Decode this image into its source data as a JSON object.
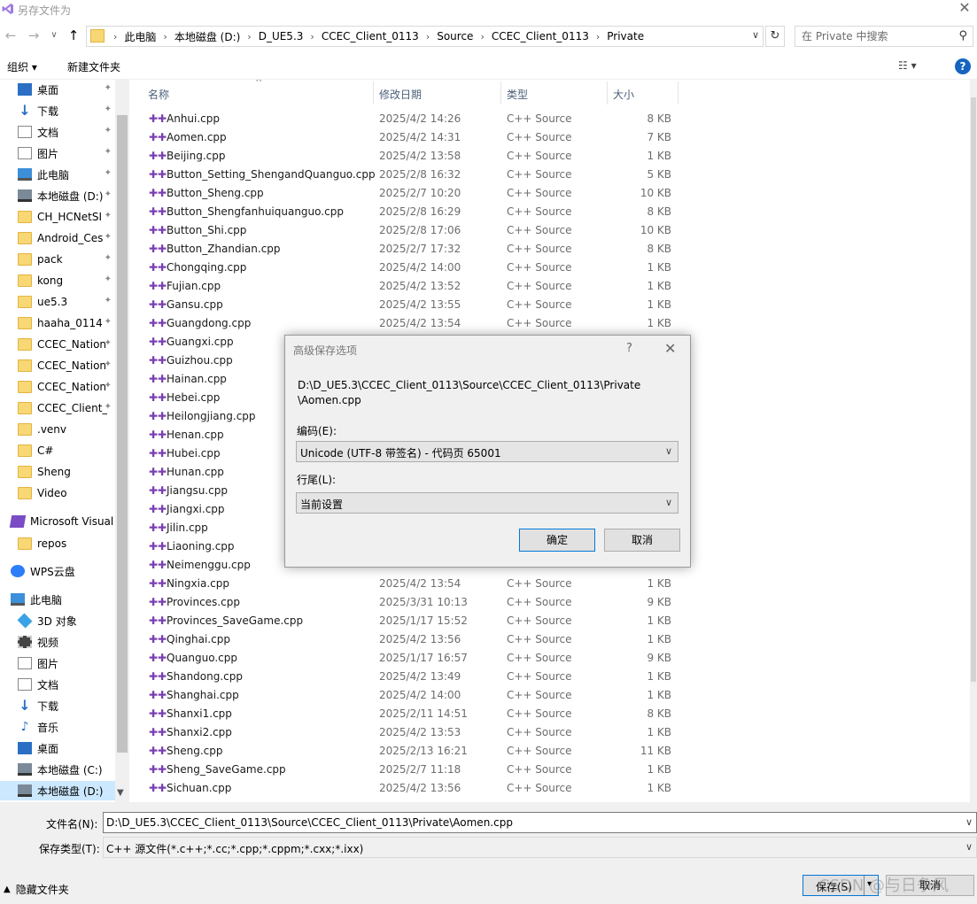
{
  "window": {
    "title": "另存文件为",
    "close_glyph": "✕"
  },
  "nav": {
    "back": "←",
    "forward": "→",
    "dropdown": "∨",
    "up": "↑",
    "refresh": "↻"
  },
  "address": {
    "crumbs": [
      "此电脑",
      "本地磁盘 (D:)",
      "D_UE5.3",
      "CCEC_Client_0113",
      "Source",
      "CCEC_Client_0113",
      "Private"
    ],
    "separator": "›",
    "dropdown": "∨"
  },
  "search": {
    "placeholder": "在 Private 中搜索",
    "icon": "⚲"
  },
  "toolbar": {
    "organize": "组织 ▾",
    "new_folder": "新建文件夹",
    "view": "☷ ▾",
    "help": "?"
  },
  "sidebar": {
    "pin": "✦",
    "items": [
      {
        "label": "桌面",
        "icon": "blue",
        "pinned": true
      },
      {
        "label": "下载",
        "icon": "down",
        "pinned": true
      },
      {
        "label": "文档",
        "icon": "doc",
        "pinned": true
      },
      {
        "label": "图片",
        "icon": "pic",
        "pinned": true
      },
      {
        "label": "此电脑",
        "icon": "pc",
        "pinned": true
      },
      {
        "label": "本地磁盘 (D:)",
        "icon": "drive",
        "pinned": true
      },
      {
        "label": "CH_HCNetSI",
        "icon": "folder",
        "pinned": true
      },
      {
        "label": "Android_Ces",
        "icon": "folder",
        "pinned": true
      },
      {
        "label": "pack",
        "icon": "folder",
        "pinned": true
      },
      {
        "label": "kong",
        "icon": "folder",
        "pinned": true
      },
      {
        "label": "ue5.3",
        "icon": "folder",
        "pinned": true
      },
      {
        "label": "haaha_0114",
        "icon": "folder",
        "pinned": true
      },
      {
        "label": "CCEC_Nation",
        "icon": "folder",
        "pinned": true
      },
      {
        "label": "CCEC_Nation",
        "icon": "folder",
        "pinned": true
      },
      {
        "label": "CCEC_Nation",
        "icon": "folder",
        "pinned": true
      },
      {
        "label": "CCEC_Client_",
        "icon": "folder",
        "pinned": true
      },
      {
        "label": ".venv",
        "icon": "folder",
        "pinned": false
      },
      {
        "label": "C#",
        "icon": "folder",
        "pinned": false
      },
      {
        "label": "Sheng",
        "icon": "folder",
        "pinned": false
      },
      {
        "label": "Video",
        "icon": "folder",
        "pinned": false
      },
      {
        "label": "Microsoft Visual",
        "icon": "vs",
        "pinned": false,
        "level": 0
      },
      {
        "label": "repos",
        "icon": "folder",
        "pinned": false
      },
      {
        "label": "WPS云盘",
        "icon": "wps",
        "pinned": false,
        "level": 0
      },
      {
        "label": "此电脑",
        "icon": "pc",
        "pinned": false,
        "level": 0
      },
      {
        "label": "3D 对象",
        "icon": "obj",
        "pinned": false
      },
      {
        "label": "视频",
        "icon": "vid",
        "pinned": false
      },
      {
        "label": "图片",
        "icon": "pic",
        "pinned": false
      },
      {
        "label": "文档",
        "icon": "doc",
        "pinned": false
      },
      {
        "label": "下载",
        "icon": "down",
        "pinned": false
      },
      {
        "label": "音乐",
        "icon": "music",
        "pinned": false
      },
      {
        "label": "桌面",
        "icon": "blue",
        "pinned": false
      },
      {
        "label": "本地磁盘 (C:)",
        "icon": "drive",
        "pinned": false
      },
      {
        "label": "本地磁盘 (D:)",
        "icon": "drive",
        "pinned": false,
        "selected": true
      }
    ]
  },
  "filelist": {
    "columns": {
      "name": "名称",
      "date": "修改日期",
      "type": "类型",
      "size": "大小"
    },
    "sort_glyph": "^",
    "file_icon": "✚✚",
    "rows": [
      {
        "name": "Anhui.cpp",
        "date": "2025/4/2 14:26",
        "type": "C++ Source",
        "size": "8 KB"
      },
      {
        "name": "Aomen.cpp",
        "date": "2025/4/2 14:31",
        "type": "C++ Source",
        "size": "7 KB"
      },
      {
        "name": "Beijing.cpp",
        "date": "2025/4/2 13:58",
        "type": "C++ Source",
        "size": "1 KB"
      },
      {
        "name": "Button_Setting_ShengandQuanguo.cpp",
        "date": "2025/2/8 16:32",
        "type": "C++ Source",
        "size": "5 KB"
      },
      {
        "name": "Button_Sheng.cpp",
        "date": "2025/2/7 10:20",
        "type": "C++ Source",
        "size": "10 KB"
      },
      {
        "name": "Button_Shengfanhuiquanguo.cpp",
        "date": "2025/2/8 16:29",
        "type": "C++ Source",
        "size": "8 KB"
      },
      {
        "name": "Button_Shi.cpp",
        "date": "2025/2/8 17:06",
        "type": "C++ Source",
        "size": "10 KB"
      },
      {
        "name": "Button_Zhandian.cpp",
        "date": "2025/2/7 17:32",
        "type": "C++ Source",
        "size": "8 KB"
      },
      {
        "name": "Chongqing.cpp",
        "date": "2025/4/2 14:00",
        "type": "C++ Source",
        "size": "1 KB"
      },
      {
        "name": "Fujian.cpp",
        "date": "2025/4/2 13:52",
        "type": "C++ Source",
        "size": "1 KB"
      },
      {
        "name": "Gansu.cpp",
        "date": "2025/4/2 13:55",
        "type": "C++ Source",
        "size": "1 KB"
      },
      {
        "name": "Guangdong.cpp",
        "date": "2025/4/2 13:54",
        "type": "C++ Source",
        "size": "1 KB"
      },
      {
        "name": "Guangxi.cpp",
        "date": "",
        "type": "",
        "size": ""
      },
      {
        "name": "Guizhou.cpp",
        "date": "",
        "type": "",
        "size": ""
      },
      {
        "name": "Hainan.cpp",
        "date": "",
        "type": "",
        "size": ""
      },
      {
        "name": "Hebei.cpp",
        "date": "",
        "type": "",
        "size": ""
      },
      {
        "name": "Heilongjiang.cpp",
        "date": "",
        "type": "",
        "size": ""
      },
      {
        "name": "Henan.cpp",
        "date": "",
        "type": "",
        "size": ""
      },
      {
        "name": "Hubei.cpp",
        "date": "",
        "type": "",
        "size": ""
      },
      {
        "name": "Hunan.cpp",
        "date": "",
        "type": "",
        "size": ""
      },
      {
        "name": "Jiangsu.cpp",
        "date": "",
        "type": "",
        "size": ""
      },
      {
        "name": "Jiangxi.cpp",
        "date": "",
        "type": "",
        "size": ""
      },
      {
        "name": "Jilin.cpp",
        "date": "",
        "type": "",
        "size": ""
      },
      {
        "name": "Liaoning.cpp",
        "date": "",
        "type": "",
        "size": ""
      },
      {
        "name": "Neimenggu.cpp",
        "date": "",
        "type": "",
        "size": ""
      },
      {
        "name": "Ningxia.cpp",
        "date": "2025/4/2 13:54",
        "type": "C++ Source",
        "size": "1 KB"
      },
      {
        "name": "Provinces.cpp",
        "date": "2025/3/31 10:13",
        "type": "C++ Source",
        "size": "9 KB"
      },
      {
        "name": "Provinces_SaveGame.cpp",
        "date": "2025/1/17 15:52",
        "type": "C++ Source",
        "size": "1 KB"
      },
      {
        "name": "Qinghai.cpp",
        "date": "2025/4/2 13:56",
        "type": "C++ Source",
        "size": "1 KB"
      },
      {
        "name": "Quanguo.cpp",
        "date": "2025/1/17 16:57",
        "type": "C++ Source",
        "size": "9 KB"
      },
      {
        "name": "Shandong.cpp",
        "date": "2025/4/2 13:49",
        "type": "C++ Source",
        "size": "1 KB"
      },
      {
        "name": "Shanghai.cpp",
        "date": "2025/4/2 14:00",
        "type": "C++ Source",
        "size": "1 KB"
      },
      {
        "name": "Shanxi1.cpp",
        "date": "2025/2/11 14:51",
        "type": "C++ Source",
        "size": "8 KB"
      },
      {
        "name": "Shanxi2.cpp",
        "date": "2025/4/2 13:53",
        "type": "C++ Source",
        "size": "1 KB"
      },
      {
        "name": "Sheng.cpp",
        "date": "2025/2/13 16:21",
        "type": "C++ Source",
        "size": "11 KB"
      },
      {
        "name": "Sheng_SaveGame.cpp",
        "date": "2025/2/7 11:18",
        "type": "C++ Source",
        "size": "1 KB"
      },
      {
        "name": "Sichuan.cpp",
        "date": "2025/4/2 13:56",
        "type": "C++ Source",
        "size": "1 KB"
      }
    ]
  },
  "bottom": {
    "filename_label": "文件名(N):",
    "filename_value": "D:\\D_UE5.3\\CCEC_Client_0113\\Source\\CCEC_Client_0113\\Private\\Aomen.cpp",
    "savetype_label": "保存类型(T):",
    "savetype_value": "C++ 源文件(*.c++;*.cc;*.cpp;*.cppm;*.cxx;*.ixx)",
    "dropdown": "∨",
    "hide_folders": "隐藏文件夹",
    "hide_caret": "▲",
    "save": "保存(S)",
    "save_dd": "▾",
    "cancel": "取消",
    "watermark": "CSDN @与日争风"
  },
  "modal": {
    "title": "高级保存选项",
    "help": "?",
    "close": "✕",
    "path_line1": "D:\\D_UE5.3\\CCEC_Client_0113\\Source\\CCEC_Client_0113\\Private",
    "path_line2": "\\Aomen.cpp",
    "encoding_label": "编码(E):",
    "encoding_value": "Unicode (UTF-8 带签名) - 代码页 65001",
    "lineend_label": "行尾(L):",
    "lineend_value": "当前设置",
    "dropdown": "∨",
    "ok": "确定",
    "cancel": "取消"
  },
  "colors": {
    "accent": "#0078d7",
    "selection": "#cce8ff",
    "help_blue": "#1565c0",
    "cpp_icon": "#7a3fb2"
  }
}
